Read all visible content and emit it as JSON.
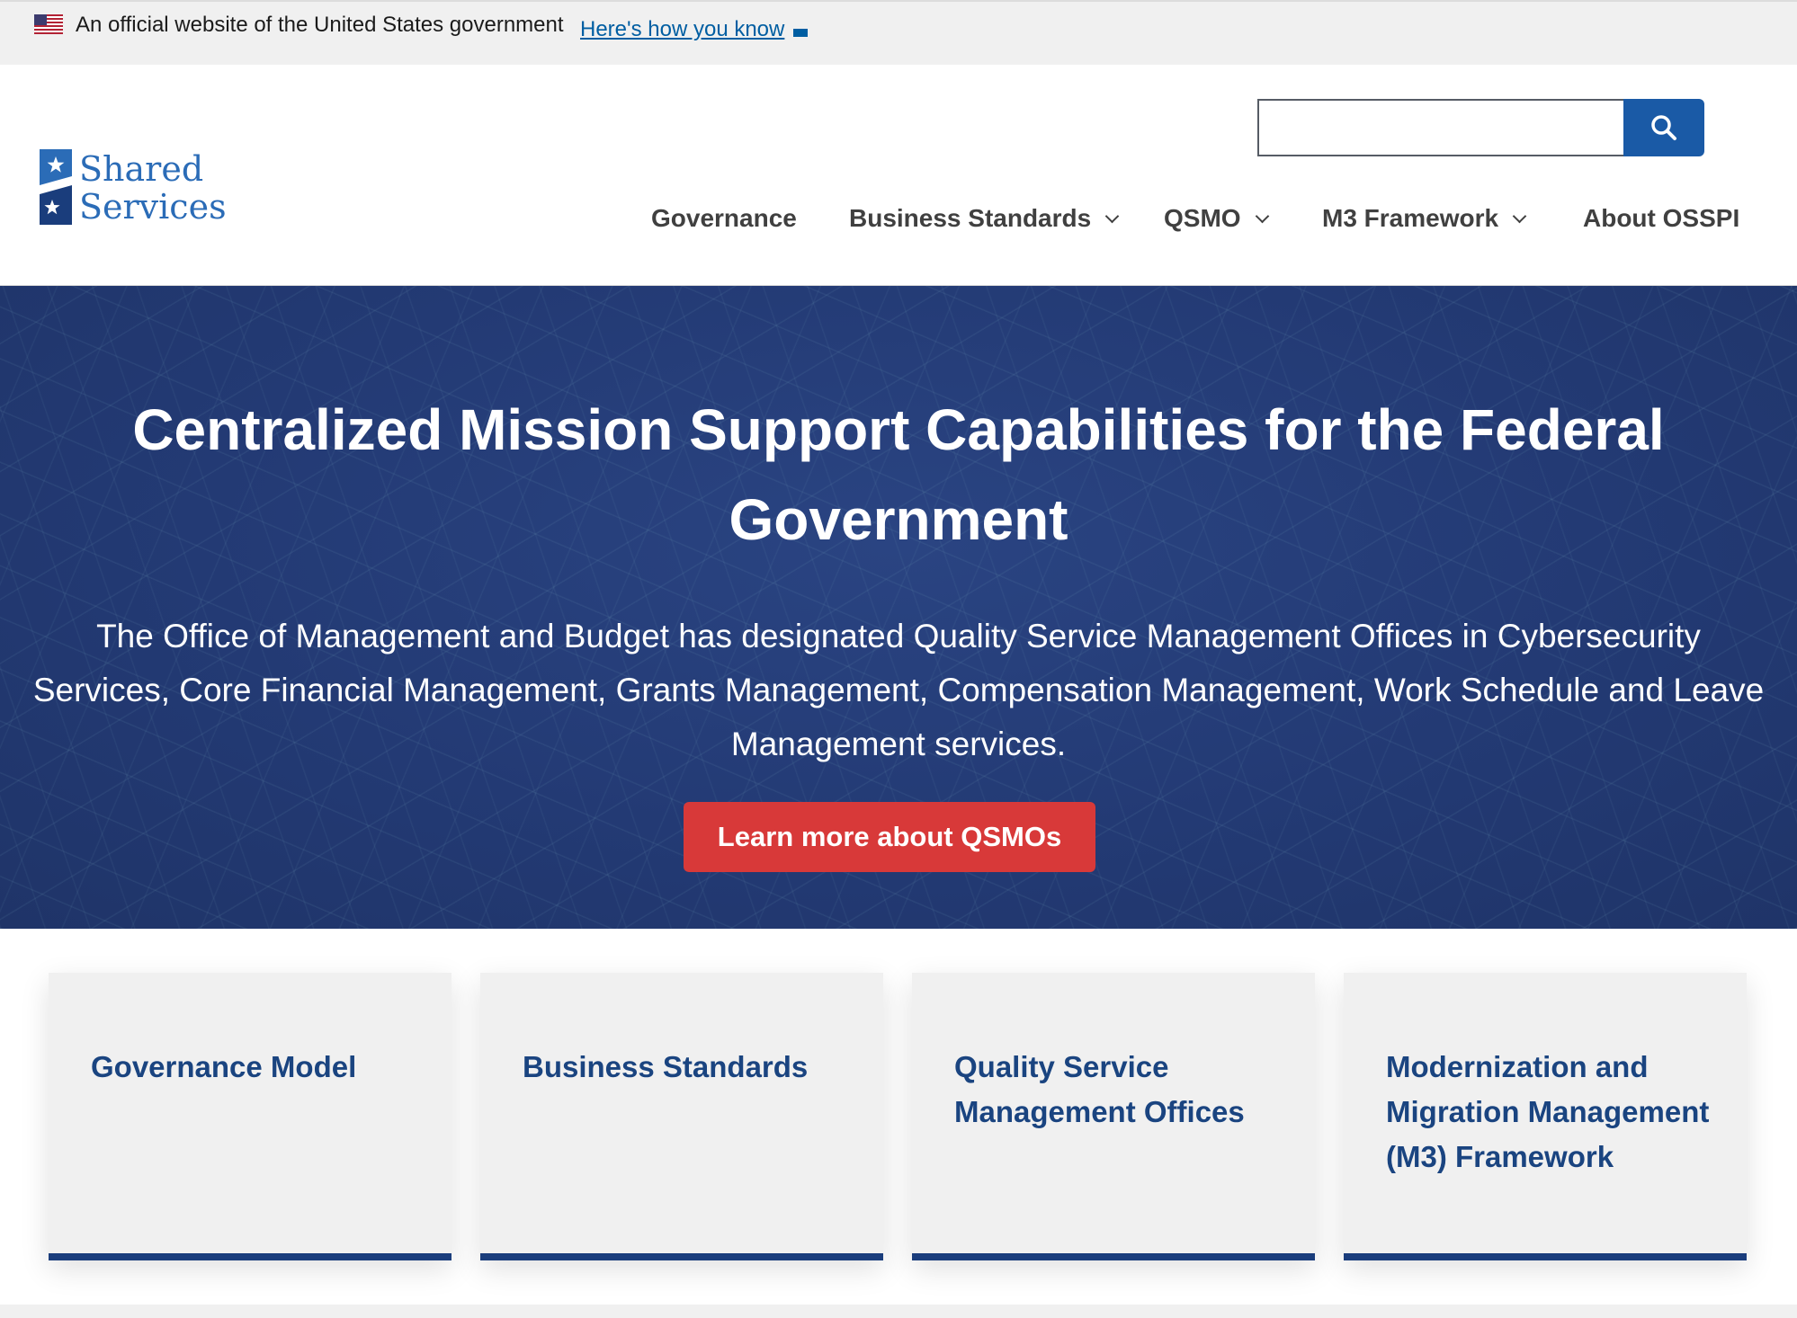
{
  "gov_banner": {
    "flag_icon": "us-flag-icon",
    "text": "An official website of the United States government",
    "link": "Here's how you know"
  },
  "header": {
    "logo": {
      "line1": "Shared",
      "line2": "Services"
    },
    "search": {
      "placeholder": "",
      "button_icon": "search-icon"
    },
    "nav": [
      {
        "label": "Governance",
        "has_dropdown": false
      },
      {
        "label": "Business Standards",
        "has_dropdown": true
      },
      {
        "label": "QSMO",
        "has_dropdown": true
      },
      {
        "label": "M3 Framework",
        "has_dropdown": true
      },
      {
        "label": "About OSSPI",
        "has_dropdown": false
      }
    ]
  },
  "hero": {
    "title": "Centralized Mission Support Capabilities for the Federal Government",
    "text": "The Office of Management and Budget has designated Quality Service Management Offices in Cybersecurity Services, Core Financial Management, Grants Management, Compensation Management, Work Schedule and Leave Management services.",
    "button": "Learn more about QSMOs"
  },
  "cards": [
    {
      "title": "Governance Model"
    },
    {
      "title": "Business Standards"
    },
    {
      "title": "Quality Service Management Offices"
    },
    {
      "title": "Modernization and Migration Management (M3) Framework"
    }
  ],
  "colors": {
    "brand_blue": "#1a4480",
    "search_button": "#1a5aa6",
    "cta_red": "#d83939",
    "hero_bg": "#233a74",
    "link": "#005ea2"
  }
}
